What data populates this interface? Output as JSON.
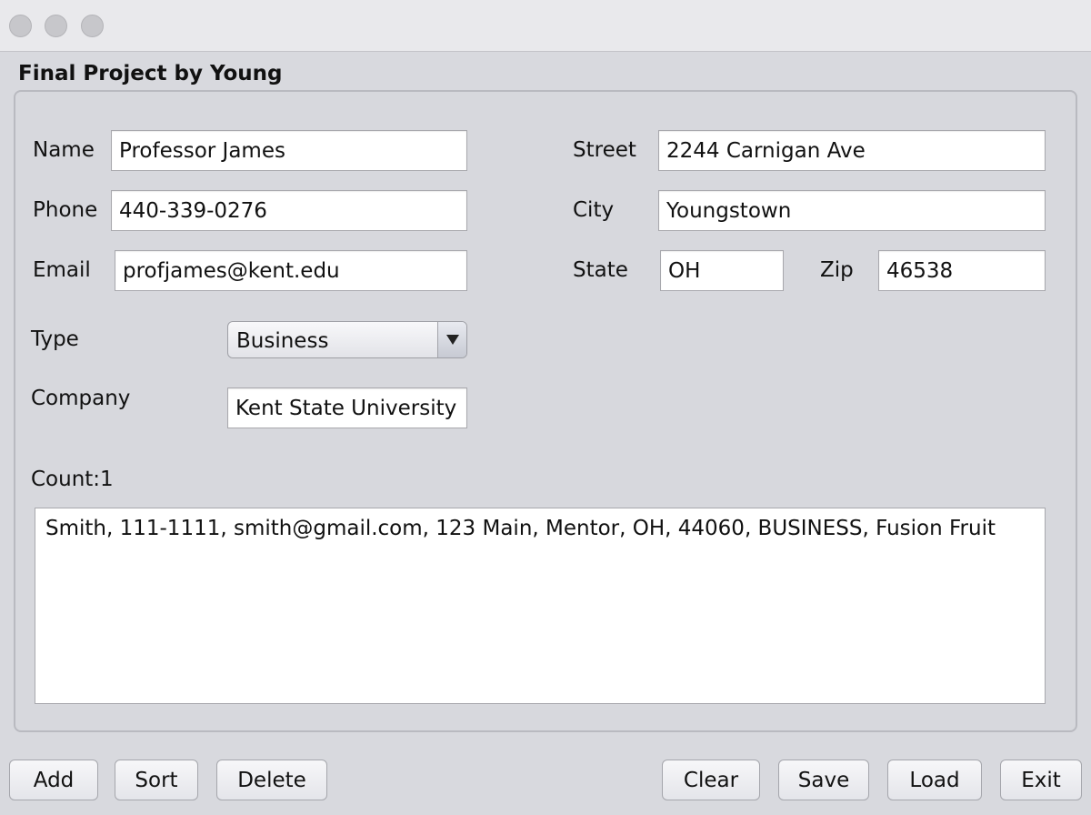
{
  "window": {
    "buttons": [
      "close",
      "minimize",
      "maximize"
    ]
  },
  "group": {
    "title": "Final Project by Young"
  },
  "form": {
    "name": {
      "label": "Name",
      "value": "Professor James"
    },
    "phone": {
      "label": "Phone",
      "value": "440-339-0276"
    },
    "email": {
      "label": "Email",
      "value": "profjames@kent.edu"
    },
    "street": {
      "label": "Street",
      "value": "2244 Carnigan Ave"
    },
    "city": {
      "label": "City",
      "value": "Youngstown"
    },
    "state": {
      "label": "State",
      "value": "OH"
    },
    "zip": {
      "label": "Zip",
      "value": "46538"
    },
    "type": {
      "label": "Type",
      "value": "Business"
    },
    "company": {
      "label": "Company",
      "value": "Kent State University"
    }
  },
  "count_label": "Count:1",
  "records": [
    "Smith, 111-1111, smith@gmail.com, 123 Main, Mentor, OH, 44060, BUSINESS, Fusion Fruit"
  ],
  "buttons": {
    "add": "Add",
    "sort": "Sort",
    "delete": "Delete",
    "clear": "Clear",
    "save": "Save",
    "load": "Load",
    "exit": "Exit"
  },
  "icons": {
    "combo_arrow": "triangle-down-icon"
  }
}
